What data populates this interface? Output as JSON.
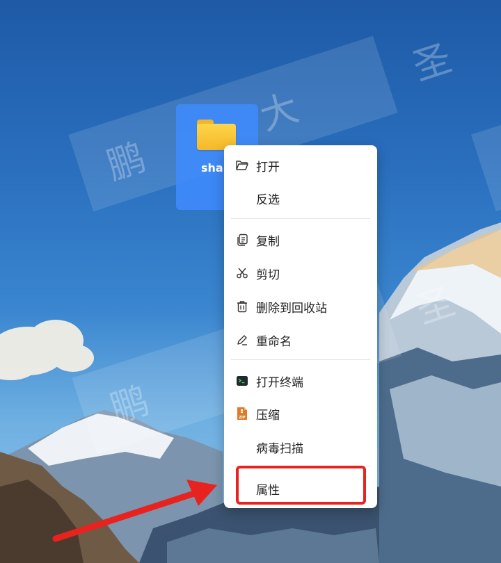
{
  "watermark": {
    "text1": "鹏 大 圣",
    "text2": "鹏 大 圣",
    "text3": "鹏"
  },
  "desktop": {
    "item_label": "shar"
  },
  "context_menu": {
    "items": [
      {
        "label": "打开",
        "icon": "folder-open-icon"
      },
      {
        "label": "反选",
        "icon": ""
      },
      {
        "label": "复制",
        "icon": "copy-icon"
      },
      {
        "label": "剪切",
        "icon": "scissors-icon"
      },
      {
        "label": "删除到回收站",
        "icon": "trash-icon"
      },
      {
        "label": "重命名",
        "icon": "rename-pen-icon"
      },
      {
        "label": "打开终端",
        "icon": "terminal-icon"
      },
      {
        "label": "压缩",
        "icon": "zip-icon"
      },
      {
        "label": "病毒扫描",
        "icon": ""
      },
      {
        "label": "属性",
        "icon": ""
      }
    ]
  },
  "annotation": {
    "highlight_color": "#e8231f"
  }
}
